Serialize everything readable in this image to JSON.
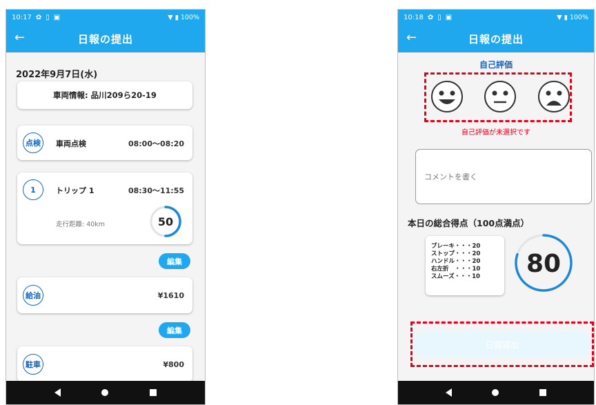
{
  "left": {
    "status": {
      "time": "10:17",
      "battery": "100%"
    },
    "appbar": {
      "back": "←",
      "title": "日報の提出"
    },
    "date": "2022年9月7日(水)",
    "vehicle_info": "車両情報: 品川209ら20-19",
    "inspection": {
      "badge": "点検",
      "title": "車両点検",
      "time": "08:00〜08:20"
    },
    "trip": {
      "badge": "1",
      "title": "トリップ 1",
      "time": "08:30〜11:55",
      "distance": "走行距離: 40km",
      "score": "50",
      "score_fraction": 0.5
    },
    "edit_label": "編集",
    "fuel": {
      "badge": "給油",
      "amount": "¥1610"
    },
    "parking": {
      "badge": "駐車",
      "amount": "¥800"
    }
  },
  "right": {
    "status": {
      "time": "10:18",
      "battery": "100%"
    },
    "appbar": {
      "back": "←",
      "title": "日報の提出"
    },
    "self_eval_label": "自己評価",
    "self_eval_error": "自己評価が未選択です",
    "comment_placeholder": "コメントを書く",
    "total_score_title": "本日の総合得点（100点満点）",
    "breakdown": [
      "ブレーキ・・・20",
      "ストップ・・・20",
      "ハンドル・・・20",
      "右左折　・・・10",
      "スムーズ・・・10"
    ],
    "total_score": "80",
    "total_score_fraction": 0.8,
    "submit_label": "日報提出"
  },
  "colors": {
    "primary": "#1fa8ee",
    "accent_dark": "#1565c0",
    "error": "#e3001b"
  }
}
